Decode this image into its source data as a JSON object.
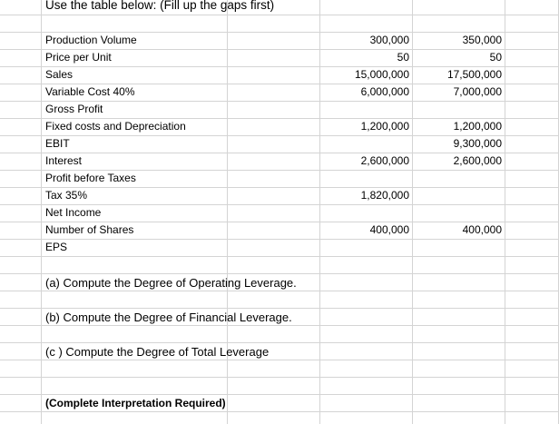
{
  "sheet": {
    "title": "Use the table below: (Fill up the gaps first)",
    "rows": [
      {
        "label": "Production Volume",
        "col1": "300,000",
        "col2": "350,000"
      },
      {
        "label": "Price per Unit",
        "col1": "50",
        "col2": "50"
      },
      {
        "label": "Sales",
        "col1": "15,000,000",
        "col2": "17,500,000"
      },
      {
        "label": "Variable Cost 40%",
        "col1": "6,000,000",
        "col2": "7,000,000"
      },
      {
        "label": "Gross Profit",
        "col1": "",
        "col2": ""
      },
      {
        "label": "Fixed costs and Depreciation",
        "col1": "1,200,000",
        "col2": "1,200,000"
      },
      {
        "label": "EBIT",
        "col1": "",
        "col2": "9,300,000"
      },
      {
        "label": "Interest",
        "col1": "2,600,000",
        "col2": "2,600,000"
      },
      {
        "label": "Profit before Taxes",
        "col1": "",
        "col2": ""
      },
      {
        "label": "Tax 35%",
        "col1": "1,820,000",
        "col2": ""
      },
      {
        "label": "Net Income",
        "col1": "",
        "col2": ""
      },
      {
        "label": "Number of Shares",
        "col1": "400,000",
        "col2": "400,000"
      },
      {
        "label": "EPS",
        "col1": "",
        "col2": ""
      }
    ],
    "questions": {
      "a": "(a) Compute the Degree of Operating Leverage.",
      "b": "(b) Compute the Degree of Financial Leverage.",
      "c": "(c )  Compute the Degree of Total Leverage"
    },
    "note": "(Complete Interpretation Required)"
  },
  "colors": {
    "gridline": "#d4d4d4",
    "text": "#000000",
    "background": "#ffffff"
  }
}
